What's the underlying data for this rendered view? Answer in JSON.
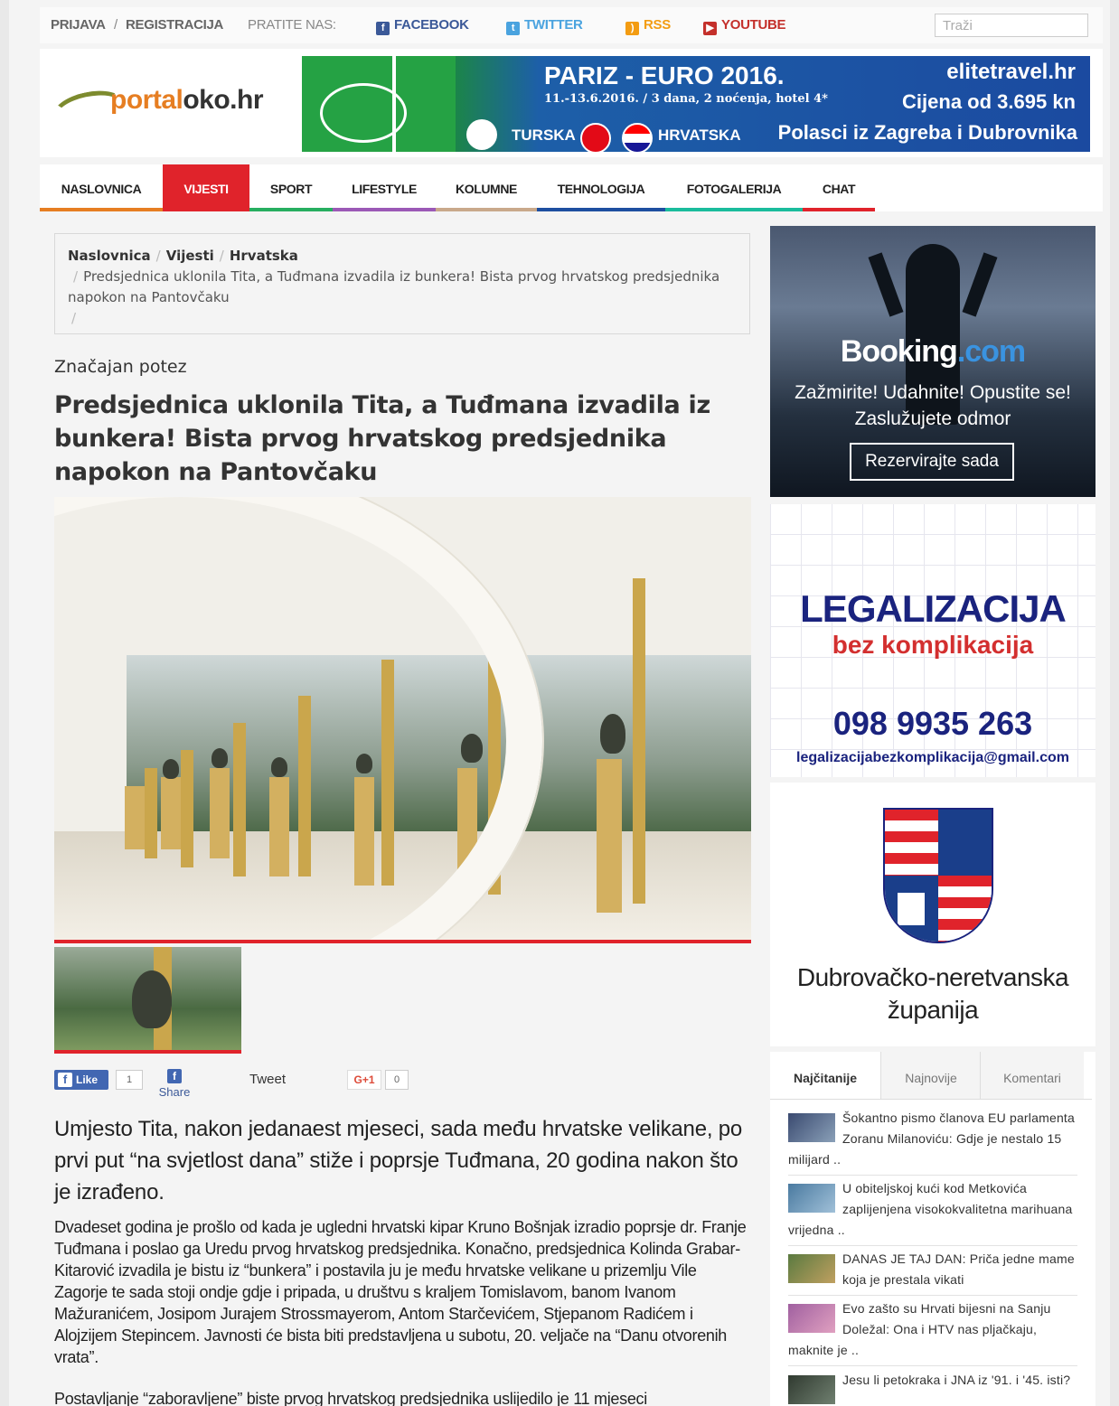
{
  "topbar": {
    "login": "PRIJAVA",
    "slash": "/",
    "register": "REGISTRACIJA",
    "follow": "PRATITE NAS:",
    "facebook": "FACEBOOK",
    "twitter": "TWITTER",
    "rss": "RSS",
    "youtube": "YOUTUBE",
    "search_placeholder": "Traži"
  },
  "header": {
    "logo_part1": "portal",
    "logo_part2": "oko.hr",
    "banner": {
      "title": "PARIZ - EURO 2016.",
      "subtitle": "11.-13.6.2016. / 3 dana, 2 noćenja, hotel 4*",
      "team1": "TURSKA",
      "team2": "HRVATSKA",
      "brand": "elitetravel.hr",
      "price": "Cijena od 3.695 kn",
      "departures": "Polasci iz Zagreba i Dubrovnika"
    }
  },
  "nav": [
    {
      "label": "NASLOVNICA",
      "color": "#e67e22"
    },
    {
      "label": "VIJESTI",
      "color": "#e0232b"
    },
    {
      "label": "SPORT",
      "color": "#27ae60"
    },
    {
      "label": "LIFESTYLE",
      "color": "#9b59b6"
    },
    {
      "label": "KOLUMNE",
      "color": "#c9a98b"
    },
    {
      "label": "TEHNOLOGIJA",
      "color": "#1e4fa0"
    },
    {
      "label": "FOTOGALERIJA",
      "color": "#1abc9c"
    },
    {
      "label": "CHAT",
      "color": "#e0232b"
    }
  ],
  "breadcrumb": {
    "home": "Naslovnica",
    "section": "Vijesti",
    "subsection": "Hrvatska",
    "current": "Predsjednica uklonila Tita, a Tuđmana izvadila iz bunkera! Bista prvog hrvatskog predsjednika napokon na Pantovčaku"
  },
  "article": {
    "kicker": "Značajan potez",
    "title": "Predsjednica uklonila Tita, a Tuđmana izvadila iz bunkera! Bista prvog hrvatskog predsjednika napokon na Pantovčaku",
    "lead": "Umjesto Tita, nakon jedanaest mjeseci, sada među hrvatske velikane, po prvi put “na svjetlost dana” stiže i poprsje Tuđmana, 20 godina nakon što je izrađeno.",
    "body": "Dvadeset godina je prošlo od kada je ugledni hrvatski kipar Kruno Bošnjak izradio poprsje dr. Franje Tuđmana i poslao ga Uredu prvog hrvatskog predsjednika. Konačno, predsjednica Kolinda Grabar-Kitarović izvadila je bistu iz “bunkera” i postavila ju je među hrvatske velikane u prizemlju Vile Zagorje te sada stoji ondje gdje i pripada, u društvu s kraljem Tomislavom, banom Ivanom Mažuranićem, Josipom Jurajem Strossmayerom, Antom Starčevićem, Stjepanom Radićem i Alojzijem Stepincem. Javnosti će bista biti predstavljena u subotu, 20. veljače na “Danu otvorenih vrata”.",
    "body2": "Postavljanje “zaboravljene” biste prvog hrvatskog predsjednika uslijedilo je 11 mjeseci"
  },
  "social": {
    "like": "Like",
    "like_count": "1",
    "share": "Share",
    "tweet": "Tweet",
    "gplus": "G+1",
    "gplus_count": "0"
  },
  "sidebar": {
    "booking": {
      "brand_main": "Booking",
      "brand_dot": ".com",
      "text": "Zažmirite! Udahnite! Opustite se! Zaslužujete odmor",
      "button": "Rezervirajte sada"
    },
    "legal": {
      "title": "LEGALIZACIJA",
      "subtitle": "bez komplikacija",
      "phone": "098 9935 263",
      "email": "legalizacijabezkomplikacija@gmail.com"
    },
    "county": {
      "name": "Dubrovačko-neretvanska županija"
    },
    "tabs": [
      "Najčitanije",
      "Najnovije",
      "Komentari"
    ],
    "news": [
      "Šokantno pismo članova EU parlamenta Zoranu Milanoviću: Gdje je nestalo 15 milijard ..",
      "U obiteljskoj kući kod Metkovića zaplijenjena visokokvalitetna marihuana vrijedna ..",
      "DANAS JE TAJ DAN: Priča jedne mame koja je prestala vikati",
      "Evo zašto su Hrvati bijesni na Sanju Doležal: Ona i HTV nas pljačkaju, maknite je ..",
      "Jesu li petokraka i JNA iz '91. i '45. isti?"
    ]
  }
}
